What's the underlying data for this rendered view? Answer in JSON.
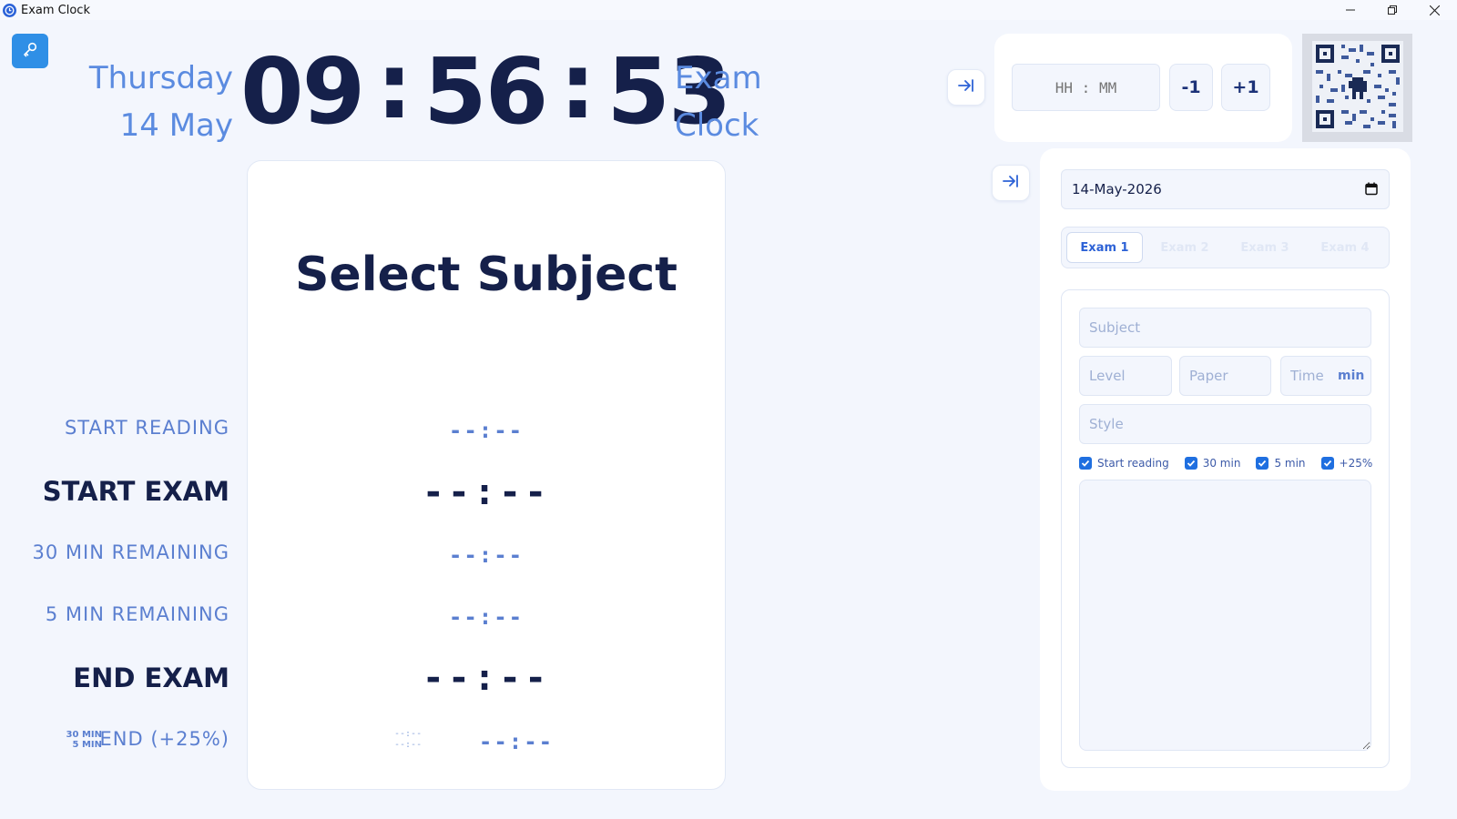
{
  "window": {
    "title": "Exam Clock",
    "controls": [
      "minimize",
      "maximize",
      "close"
    ]
  },
  "header": {
    "weekday": "Thursday",
    "date_short": "14 May",
    "clock": {
      "hours": "09",
      "minutes": "56",
      "seconds": "53"
    },
    "app_name_line1": "Exam",
    "app_name_line2": "Clock"
  },
  "main": {
    "subject_title": "Select Subject",
    "rows": [
      {
        "label": "START READING",
        "time": "--:--",
        "emphasis": false
      },
      {
        "label": "START EXAM",
        "time": "--:--",
        "emphasis": true
      },
      {
        "label": "30 MIN REMAINING",
        "time": "--:--",
        "emphasis": false
      },
      {
        "label": "5 MIN REMAINING",
        "time": "--:--",
        "emphasis": false
      },
      {
        "label": "END EXAM",
        "time": "--:--",
        "emphasis": true
      },
      {
        "label": "END (+25%)",
        "time": "--:--",
        "emphasis": false
      }
    ],
    "extra_labels": {
      "thirty": "30 MIN",
      "five": "5 MIN"
    },
    "extra_times": {
      "thirty": "--:--",
      "five": "--:--"
    }
  },
  "time_adjust": {
    "placeholder": "HH : MM",
    "minus_label": "-1",
    "plus_label": "+1"
  },
  "settings": {
    "date_value": "14-May-2026",
    "tabs": [
      {
        "label": "Exam 1",
        "active": true
      },
      {
        "label": "Exam 2",
        "active": false
      },
      {
        "label": "Exam 3",
        "active": false
      },
      {
        "label": "Exam 4",
        "active": false
      }
    ],
    "fields": {
      "subject_placeholder": "Subject",
      "level_placeholder": "Level",
      "paper_placeholder": "Paper",
      "time_placeholder": "Time",
      "time_unit": "min",
      "style_placeholder": "Style"
    },
    "checkboxes": [
      {
        "label": "Start reading",
        "checked": true
      },
      {
        "label": "30 min",
        "checked": true
      },
      {
        "label": "5 min",
        "checked": true
      },
      {
        "label": "+25%",
        "checked": true
      }
    ]
  },
  "colors": {
    "accent": "#2d62d6",
    "dark_text": "#15204a",
    "muted_text": "#5b7fd0",
    "background": "#f3f6fd"
  },
  "icons": {
    "key_button": "key-icon",
    "collapse": "arrow-to-right-icon",
    "calendar": "calendar-icon",
    "qr": "qr-code-icon"
  }
}
